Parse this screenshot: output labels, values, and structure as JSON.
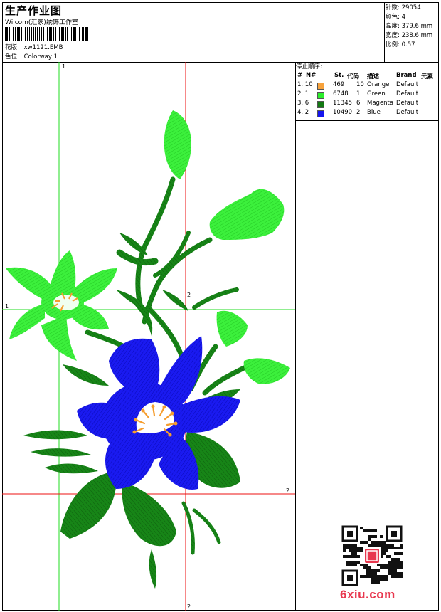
{
  "header": {
    "title": "生产作业图",
    "company": "Wilcom(汇家)绣饰工作室",
    "design_label": "花版:",
    "design_value": "xw1121.EMB",
    "color_label": "色位:",
    "color_value": "Colorway 1"
  },
  "stats": {
    "stitches_label": "针数:",
    "stitches_value": "29054",
    "colors_label": "颜色:",
    "colors_value": "4",
    "height_label": "高度:",
    "height_value": "379.6 mm",
    "width_label": "宽度:",
    "width_value": "238.6 mm",
    "ratio_label": "比例:",
    "ratio_value": "0.57"
  },
  "stop_sequence": {
    "title": "停止顺序:",
    "columns": [
      "#",
      "N#",
      "St.",
      "代码",
      "描述",
      "Brand",
      "元素"
    ],
    "rows": [
      {
        "idx": "1. 10",
        "stitches": "469",
        "code": "10",
        "desc": "Orange",
        "brand": "Default",
        "color": "#f7a23c"
      },
      {
        "idx": "2. 1",
        "stitches": "6748",
        "code": "1",
        "desc": "Green",
        "brand": "Default",
        "color": "#2bee2b"
      },
      {
        "idx": "3. 6",
        "stitches": "11345",
        "code": "6",
        "desc": "Magenta",
        "brand": "Default",
        "color": "#137a13"
      },
      {
        "idx": "4. 2",
        "stitches": "10490",
        "code": "2",
        "desc": "Blue",
        "brand": "Default",
        "color": "#1515ee"
      }
    ]
  },
  "guides": {
    "v1": "1",
    "h1": "1",
    "h2": "2",
    "v2_top": "2",
    "v2_bottom": "2"
  },
  "watermark": "6xiu.com",
  "colors": {
    "guide_green": "#22dd22",
    "guide_red": "#ee1111",
    "petal_blue": "#1515ee",
    "petal_green": "#3cf03c",
    "leaf_dark": "#167a16",
    "center_orange": "#f59d2e",
    "watermark_red": "#e8384f"
  }
}
